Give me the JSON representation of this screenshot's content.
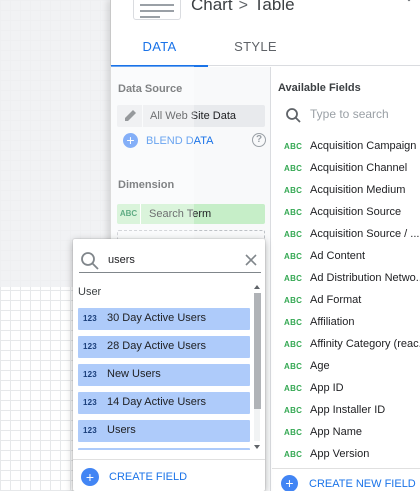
{
  "header": {
    "chart_label": "Chart",
    "separator": ">",
    "type_label": "Table"
  },
  "tabs": [
    {
      "label": "DATA",
      "active": true
    },
    {
      "label": "STYLE",
      "active": false
    }
  ],
  "data_panel": {
    "data_source_label": "Data Source",
    "data_source_name": "All Web Site Data",
    "blend_label": "BLEND DATA",
    "dimension_label": "Dimension",
    "dimension_type": "ABC",
    "dimension_value": "Search Term"
  },
  "available_fields": {
    "title": "Available Fields",
    "search_placeholder": "Type to search",
    "type_badge": "ABC",
    "items": [
      "Acquisition Campaign",
      "Acquisition Channel",
      "Acquisition Medium",
      "Acquisition Source",
      "Acquisition Source / ...",
      "Ad Content",
      "Ad Distribution Netwo...",
      "Ad Format",
      "Affiliation",
      "Affinity Category (reac...",
      "Age",
      "App ID",
      "App Installer ID",
      "App Name",
      "App Version"
    ],
    "create_label": "CREATE NEW FIELD"
  },
  "dropdown": {
    "search_value": "users",
    "group_label": "User",
    "type_badge": "123",
    "items": [
      "30 Day Active Users",
      "28 Day Active Users",
      "New Users",
      "14 Day Active Users",
      "Users"
    ],
    "create_label": "CREATE FIELD"
  },
  "colors": {
    "accent": "#1a73e8",
    "dimension_chip": "#c6eec8",
    "metric_chip": "#aecbfa",
    "dimension_badge": "#34a853"
  },
  "icons": {
    "search": "search-icon",
    "clear": "close-icon",
    "edit": "pencil-icon",
    "help": "help-icon",
    "add": "plus-circle-icon",
    "chevron": "chevron-down-icon"
  }
}
